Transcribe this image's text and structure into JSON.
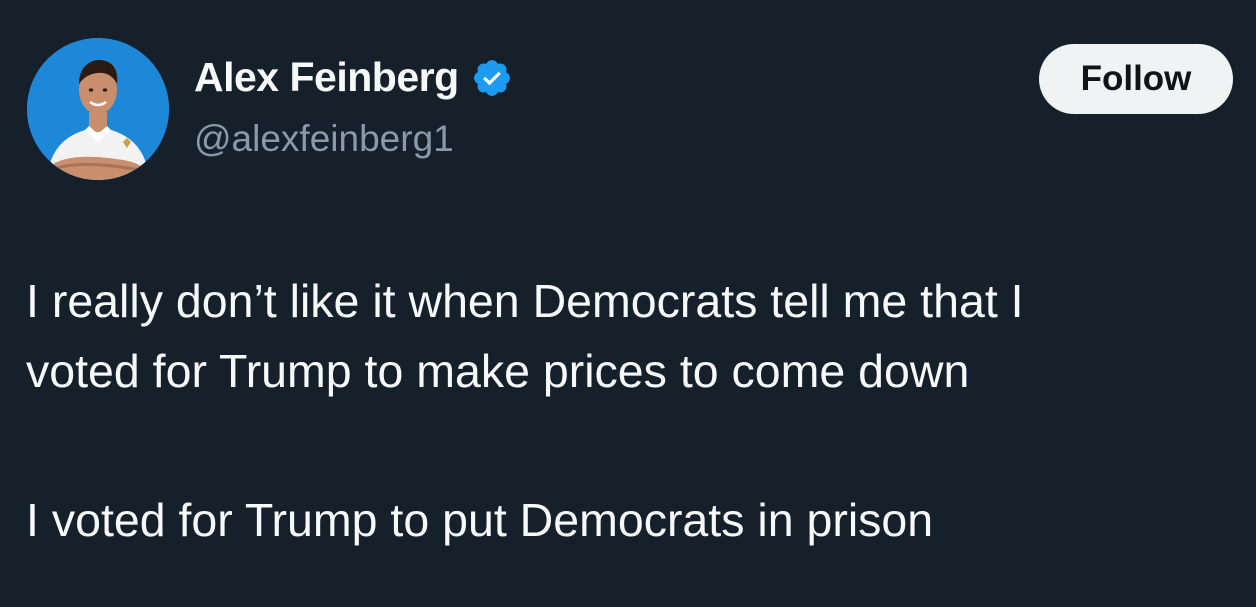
{
  "author": {
    "display_name": "Alex Feinberg",
    "handle": "@alexfeinberg1",
    "verified": true,
    "avatar_icon": "profile-photo",
    "verified_icon": "verified-badge-icon"
  },
  "actions": {
    "follow_label": "Follow"
  },
  "tweet": {
    "lines": [
      "I really don’t like it when Democrats tell me that I",
      "voted for Trump to make prices to come down",
      "I voted for Trump to put Democrats in prison"
    ]
  },
  "colors": {
    "background": "#15202b",
    "text": "#f7f9f9",
    "secondary_text": "#8b98a5",
    "verified": "#1d9bf0",
    "follow_bg": "#eff3f4"
  }
}
